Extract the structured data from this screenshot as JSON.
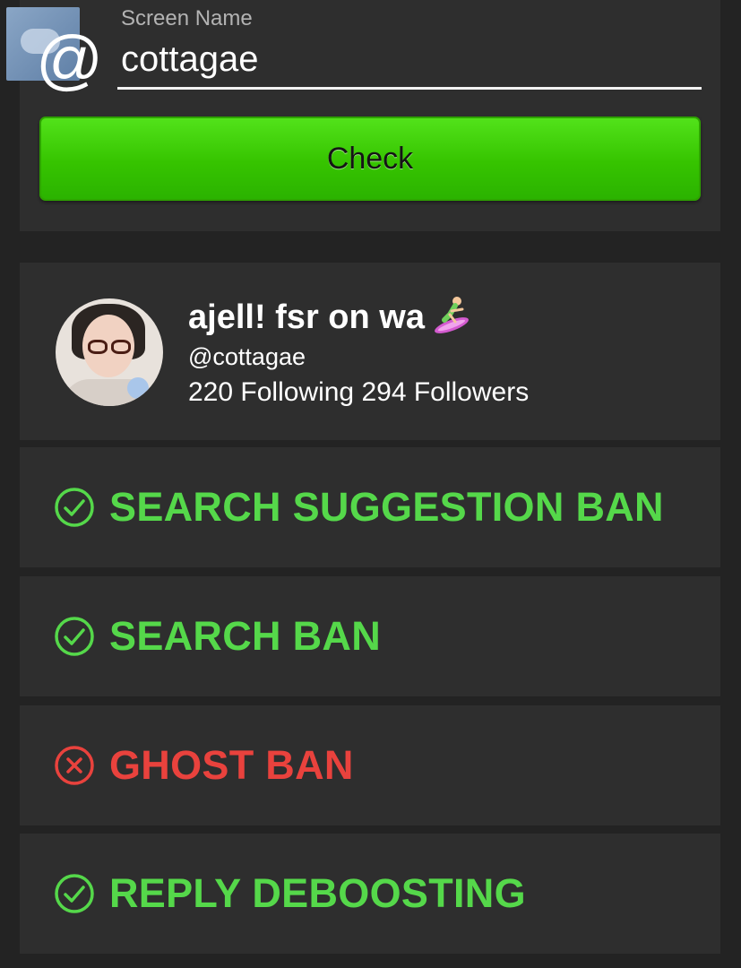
{
  "search": {
    "label": "Screen Name",
    "value": "cottagae",
    "at_symbol": "@",
    "button_label": "Check"
  },
  "profile": {
    "display_name": "ajell! fsr on wa",
    "handle": "@cottagae",
    "stats": "220 Following 294 Followers"
  },
  "results": [
    {
      "label": "SEARCH SUGGESTION BAN",
      "status": "pass",
      "icon": "check-circle-icon"
    },
    {
      "label": "SEARCH BAN",
      "status": "pass",
      "icon": "check-circle-icon"
    },
    {
      "label": "GHOST BAN",
      "status": "fail",
      "icon": "x-circle-icon"
    },
    {
      "label": "REPLY DEBOOSTING",
      "status": "pass",
      "icon": "check-circle-icon"
    }
  ],
  "colors": {
    "pass": "#55d84a",
    "fail": "#e9423d",
    "button": "#36c400",
    "card": "#2e2e2e",
    "background": "#232323"
  }
}
